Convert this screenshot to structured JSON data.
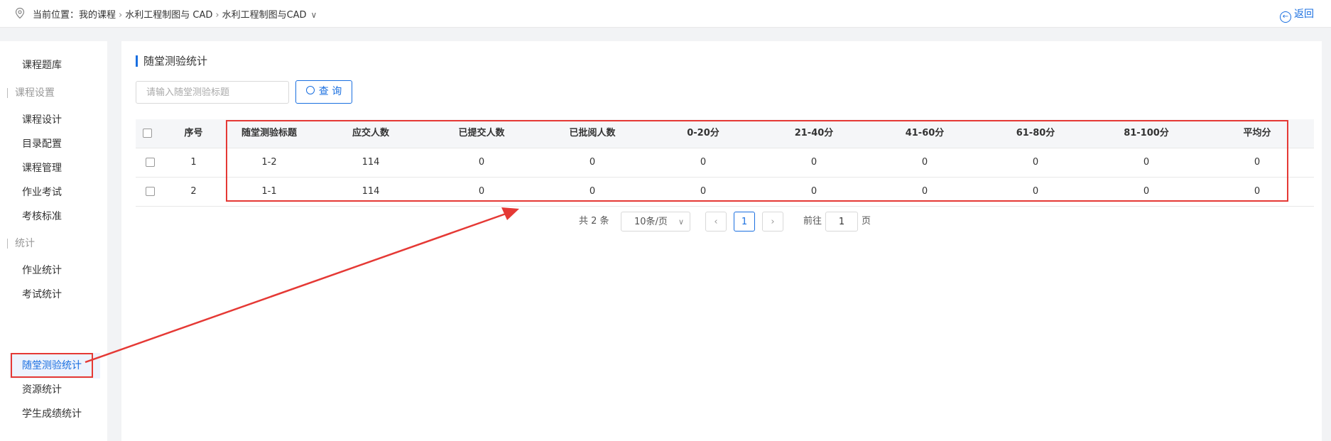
{
  "topbar": {
    "location_label": "当前位置：",
    "crumbs": [
      "我的课程",
      "水利工程制图与 CAD",
      "水利工程制图与CAD"
    ],
    "caret": "∨",
    "back_label": "返回"
  },
  "sidebar": {
    "items": [
      {
        "label": "课程题库"
      },
      {
        "group": "课程设置"
      },
      {
        "label": "课程设计"
      },
      {
        "label": "目录配置"
      },
      {
        "label": "课程管理"
      },
      {
        "label": "作业考试"
      },
      {
        "label": "考核标准"
      },
      {
        "group": "统计"
      },
      {
        "label": "作业统计"
      },
      {
        "label": "考试统计"
      },
      {
        "label": "随堂测验统计",
        "active": true
      },
      {
        "label": "资源统计"
      },
      {
        "label": "学生成绩统计"
      }
    ]
  },
  "main": {
    "title": "随堂测验统计",
    "search_placeholder": "请输入随堂测验标题",
    "query_label": "查 询",
    "table": {
      "headers": [
        "序号",
        "随堂测验标题",
        "应交人数",
        "已提交人数",
        "已批阅人数",
        "0-20分",
        "21-40分",
        "41-60分",
        "61-80分",
        "81-100分",
        "平均分"
      ],
      "rows": [
        [
          "1",
          "1-2",
          "114",
          "0",
          "0",
          "0",
          "0",
          "0",
          "0",
          "0",
          "0"
        ],
        [
          "2",
          "1-1",
          "114",
          "0",
          "0",
          "0",
          "0",
          "0",
          "0",
          "0",
          "0"
        ]
      ]
    },
    "pagination": {
      "total": "共 2 条",
      "page_size": "10条/页",
      "current_page": "1",
      "goto_prefix": "前往",
      "goto_value": "1",
      "goto_suffix": "页"
    }
  },
  "colors": {
    "accent": "#1a6fe0",
    "annotation": "#e53935"
  }
}
